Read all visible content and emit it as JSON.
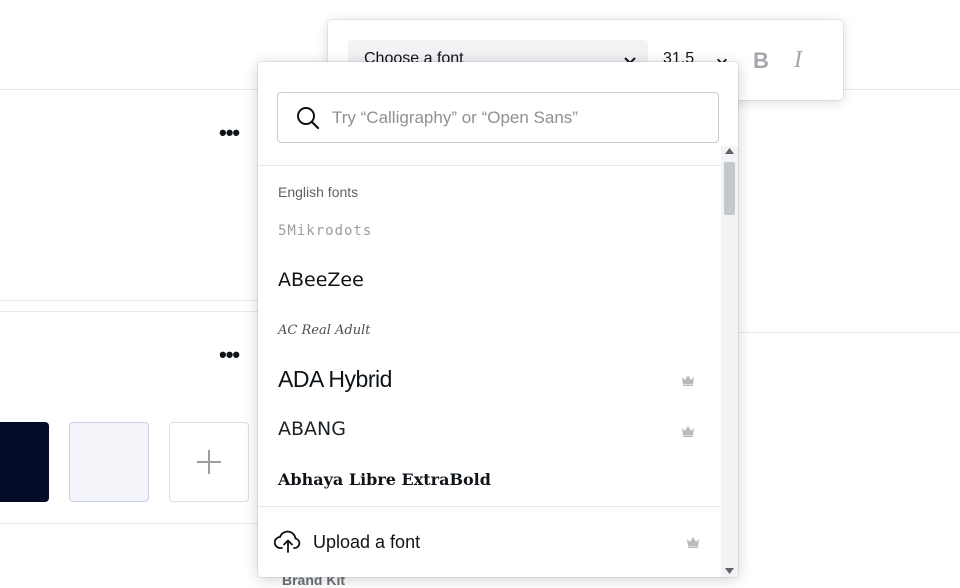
{
  "toolbar": {
    "font_select_value": "Choose a font",
    "font_size_value": "31.5",
    "bold_label": "B",
    "italic_label": "I"
  },
  "font_picker": {
    "search_placeholder": "Try “Calligraphy” or “Open Sans”",
    "section_title": "English fonts",
    "fonts": [
      {
        "name": "5Mikrodots",
        "premium": false
      },
      {
        "name": "ABeeZee",
        "premium": false
      },
      {
        "name": "AC Real Adult",
        "premium": false
      },
      {
        "name": "ADA Hybrid",
        "premium": true
      },
      {
        "name": "ABANG",
        "premium": true
      },
      {
        "name": "Abhaya Libre ExtraBold",
        "premium": false
      }
    ],
    "upload_label": "Upload a font",
    "upload_premium": true
  },
  "background": {
    "swatch_colors": [
      "#050c2a",
      "#f4f5fb"
    ],
    "partial_text": "Brand Kit"
  },
  "colors": {
    "crown": "#b8babe",
    "toolbar_disabled": "#a4a7ab"
  }
}
